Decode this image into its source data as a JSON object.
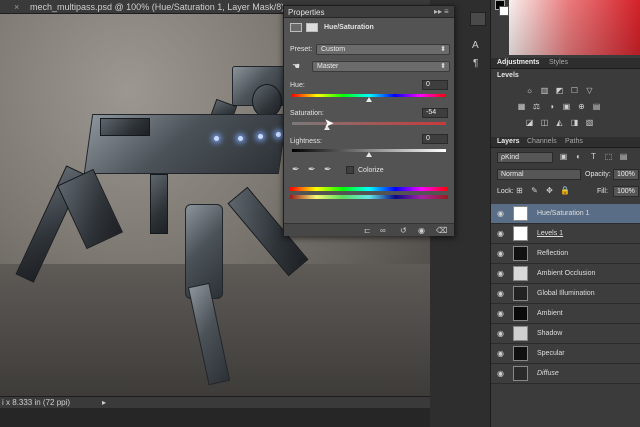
{
  "document": {
    "tab_title": "mech_multipass.psd @ 100% (Hue/Saturation 1, Layer Mask/8)",
    "close_glyph": "×",
    "status_text": "i x 8.333 in (72 ppi)",
    "status_arrow": "▸"
  },
  "properties": {
    "title": "Properties",
    "header_label": "Hue/Saturation",
    "preset_label": "Preset:",
    "preset_value": "Custom",
    "channel_value": "Master",
    "hue_label": "Hue:",
    "hue_value": "0",
    "saturation_label": "Saturation:",
    "saturation_value": "-54",
    "lightness_label": "Lightness:",
    "lightness_value": "0",
    "colorize_label": "Colorize",
    "collapse_glyph": "▸▸",
    "menu_glyph": "≡",
    "caret_glyph": "⬍",
    "eyedropper_glyph": "✒",
    "hue_position": 0.5,
    "saturation_position": 0.23,
    "lightness_position": 0.5
  },
  "dock": {
    "tabs_top": [
      {
        "label": "Adjustments",
        "active": true
      },
      {
        "label": "Styles",
        "active": false
      }
    ],
    "adjustments_title": "Levels",
    "adjustment_icons_row1": [
      "☼",
      "▥",
      "◩",
      "☐",
      "▽"
    ],
    "adjustment_icons_row2": [
      "▦",
      "⚖",
      "◑",
      "▣",
      "⊕",
      "▤"
    ],
    "adjustment_icons_row3": [
      "◪",
      "◫",
      "◭",
      "◨",
      "▧"
    ],
    "tabs_layers": [
      {
        "label": "Layers",
        "active": true
      },
      {
        "label": "Channels",
        "active": false
      },
      {
        "label": "Paths",
        "active": false
      }
    ],
    "kind_filter": "ρKind",
    "filter_icons": [
      "▣",
      "◐",
      "T",
      "⬚",
      "▤"
    ],
    "blend_mode": "Normal",
    "opacity_label": "Opacity:",
    "opacity_value": "100%",
    "lock_label": "Lock:",
    "lock_icons": [
      "⊞",
      "✎",
      "✥",
      "🔒"
    ],
    "fill_label": "Fill:",
    "fill_value": "100%",
    "layers": [
      {
        "name": "Hue/Saturation 1",
        "selected": true
      },
      {
        "name": "Levels 1",
        "selected": false
      },
      {
        "name": "Reflection",
        "selected": false
      },
      {
        "name": "Ambient Occlusion",
        "selected": false
      },
      {
        "name": "Global Illumination",
        "selected": false
      },
      {
        "name": "Ambient",
        "selected": false
      },
      {
        "name": "Shadow",
        "selected": false
      },
      {
        "name": "Specular",
        "selected": false
      },
      {
        "name": "Diffuse",
        "selected": false
      }
    ],
    "eye_glyph": "◉"
  },
  "colors": {
    "selected_layer": "#5a6d86",
    "panel_bg": "#535353",
    "dock_bg": "#3b3b3b"
  }
}
